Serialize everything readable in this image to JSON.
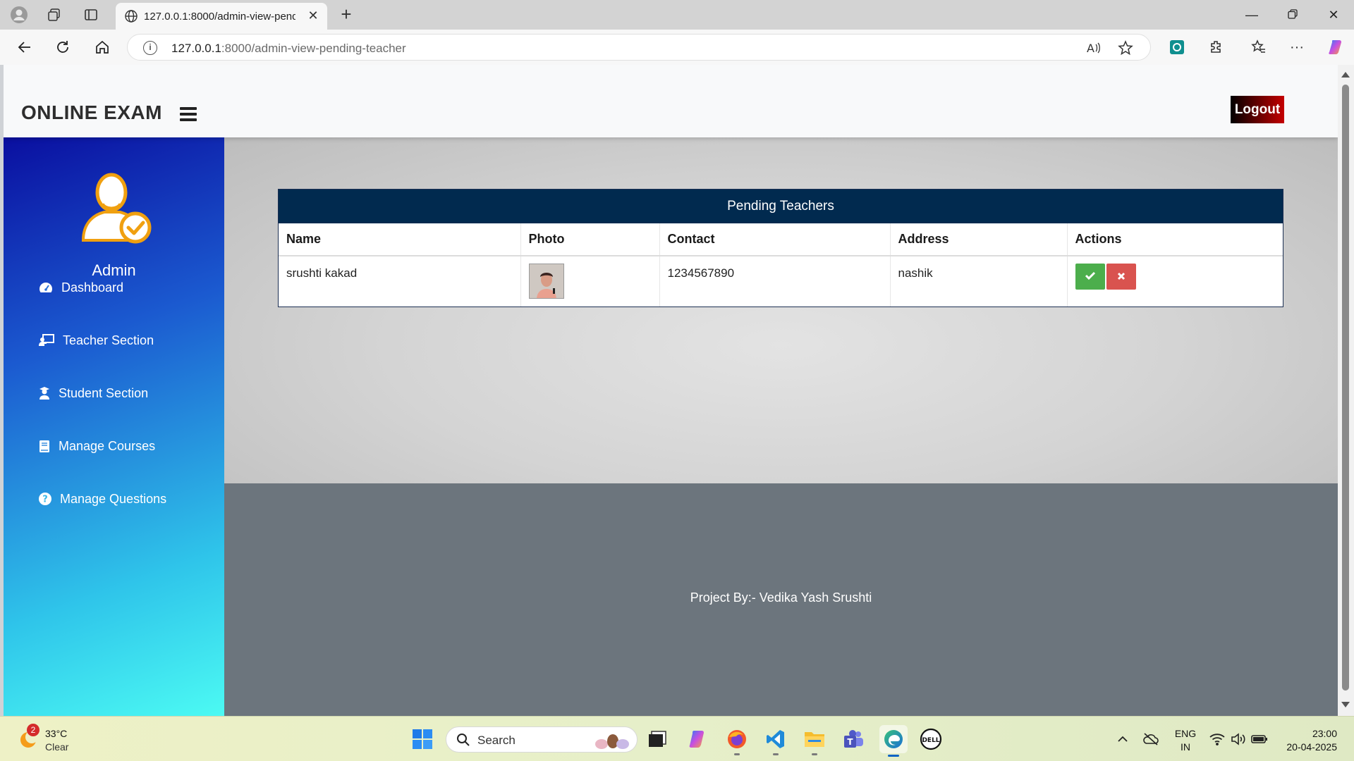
{
  "browser": {
    "tab_title": "127.0.0.1:8000/admin-view-pendi",
    "url_host": "127.0.0.1",
    "url_rest": ":8000/admin-view-pending-teacher"
  },
  "header": {
    "brand": "ONLINE EXAM",
    "logout_label": "Logout"
  },
  "sidebar": {
    "user_name": "Admin",
    "items": [
      {
        "label": "Dashboard",
        "icon": "dashboard-icon"
      },
      {
        "label": "Teacher Section",
        "icon": "teacher-icon"
      },
      {
        "label": "Student Section",
        "icon": "student-icon"
      },
      {
        "label": "Manage Courses",
        "icon": "book-icon"
      },
      {
        "label": "Manage Questions",
        "icon": "question-icon"
      }
    ]
  },
  "panel": {
    "title": "Pending Teachers",
    "columns": [
      "Name",
      "Photo",
      "Contact",
      "Address",
      "Actions"
    ],
    "rows": [
      {
        "name": "srushti kakad",
        "contact": "1234567890",
        "address": "nashik"
      }
    ]
  },
  "footer": {
    "text": "Project By:- Vedika Yash Srushti"
  },
  "taskbar": {
    "weather_badge": "2",
    "temperature": "33°C",
    "condition": "Clear",
    "search_placeholder": "Search",
    "lang_top": "ENG",
    "lang_bottom": "IN",
    "time": "23:00",
    "date": "20-04-2025"
  },
  "colors": {
    "panel_header": "#012a4f",
    "approve": "#4cae4c",
    "reject": "#d9534f",
    "footer": "#6c757d"
  }
}
